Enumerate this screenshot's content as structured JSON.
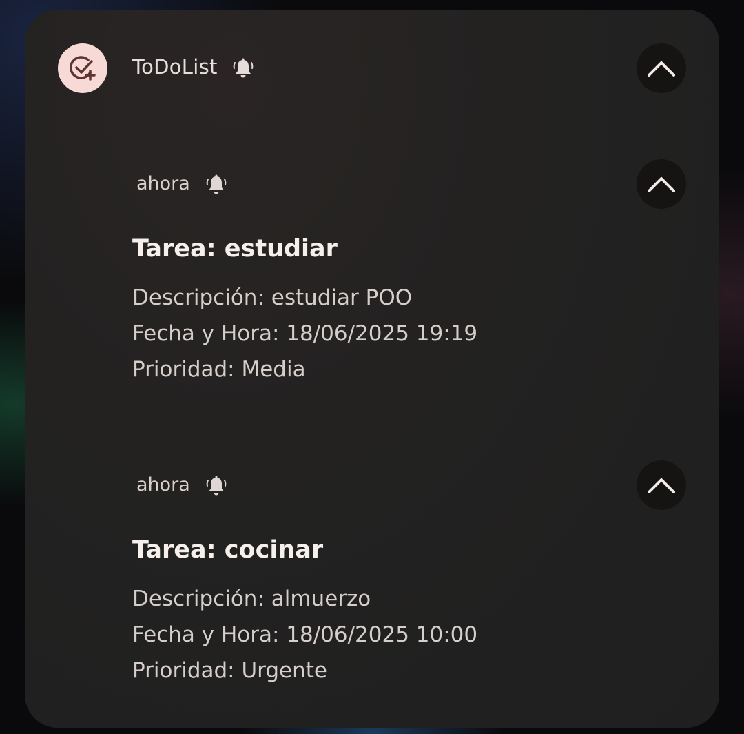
{
  "header": {
    "app_name": "ToDoList",
    "app_icon": "task-check-add-icon",
    "bell_icon": "alarm-bell-icon",
    "collapse_icon": "chevron-up-icon"
  },
  "notifications": [
    {
      "time": "ahora",
      "title": "Tarea: estudiar",
      "description": "Descripción: estudiar POO",
      "datetime": "Fecha y Hora: 18/06/2025 19:19",
      "priority": "Prioridad: Media"
    },
    {
      "time": "ahora",
      "title": "Tarea: cocinar",
      "description": "Descripción: almuerzo",
      "datetime": "Fecha y Hora: 18/06/2025 10:00",
      "priority": "Prioridad: Urgente"
    }
  ],
  "colors": {
    "panel_bg": "#232221",
    "icon_bg": "#f7dad5",
    "icon_fg": "#6b3b37",
    "text_primary": "#f6efec",
    "text_secondary": "#d6cecb"
  }
}
